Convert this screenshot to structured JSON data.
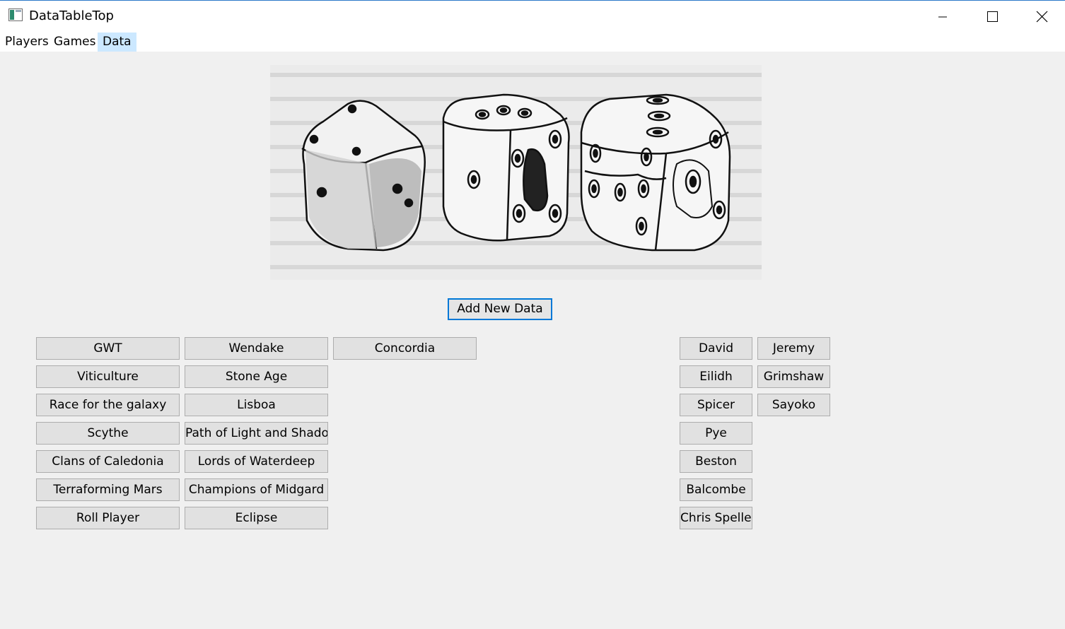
{
  "window": {
    "title": "DataTableTop",
    "app_icon": "app-window-icon",
    "controls": [
      "minimize-icon",
      "maximize-icon",
      "close-icon"
    ]
  },
  "menu": {
    "items": [
      {
        "label": "Players"
      },
      {
        "label": "Games"
      },
      {
        "label": "Data",
        "active": true
      }
    ]
  },
  "main": {
    "image_description": "dice-illustration",
    "add_button": "Add New Data"
  },
  "games": {
    "columns": [
      [
        "GWT",
        "Viticulture",
        "Race for the galaxy",
        "Scythe",
        "Clans of Caledonia",
        "Terraforming Mars",
        "Roll Player"
      ],
      [
        "Wendake",
        "Stone Age",
        "Lisboa",
        "Path of Light and Shadow",
        "Lords of Waterdeep",
        "Champions of Midgard",
        "Eclipse"
      ],
      [
        "Concordia"
      ]
    ]
  },
  "players": {
    "columns": [
      [
        "David",
        "Eilidh",
        "Spicer",
        "Pye",
        "Beston",
        "Balcombe",
        "Chris Speller"
      ],
      [
        "Jeremy",
        "Grimshaw",
        "Sayoko"
      ]
    ]
  },
  "colors": {
    "background": "#f0f0f0",
    "button": "#e1e1e1",
    "button_border": "#adadad",
    "focus": "#0078d7",
    "menu_active": "#cce8ff"
  }
}
